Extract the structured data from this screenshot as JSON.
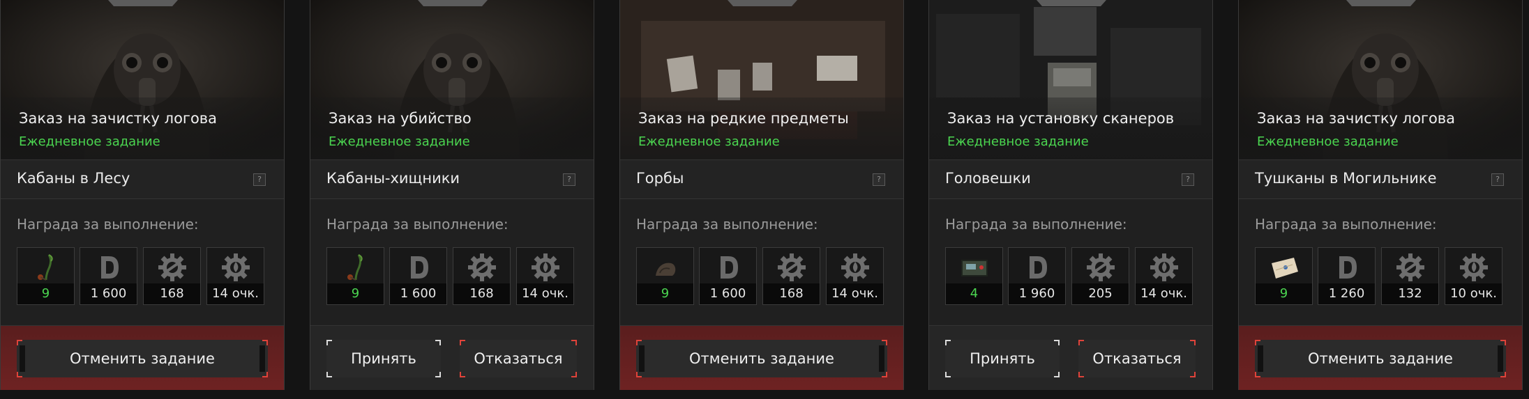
{
  "common": {
    "reward_label": "Награда за выполнение:",
    "help_symbol": "?"
  },
  "cards": [
    {
      "order_title": "Заказ на зачистку логова",
      "daily_label": "Ежедневное задание",
      "target": "Кабаны в Лесу",
      "art": "stalker",
      "rewards": [
        {
          "icon": "plant-icon",
          "value": "9",
          "highlight": true
        },
        {
          "icon": "currency-d-icon",
          "value": "1 600"
        },
        {
          "icon": "gear-wrench-icon",
          "value": "168"
        },
        {
          "icon": "gear-flame-icon",
          "value": "14 очк."
        }
      ],
      "buttons": {
        "cancel": "Отменить задание"
      }
    },
    {
      "order_title": "Заказ на убийство",
      "daily_label": "Ежедневное задание",
      "target": "Кабаны-хищники",
      "art": "stalker",
      "rewards": [
        {
          "icon": "plant-icon",
          "value": "9",
          "highlight": true
        },
        {
          "icon": "currency-d-icon",
          "value": "1 600"
        },
        {
          "icon": "gear-wrench-icon",
          "value": "168"
        },
        {
          "icon": "gear-flame-icon",
          "value": "14 очк."
        }
      ],
      "buttons": {
        "accept": "Принять",
        "decline": "Отказаться"
      }
    },
    {
      "order_title": "Заказ на редкие предметы",
      "daily_label": "Ежедневное задание",
      "target": "Горбы",
      "art": "board",
      "rewards": [
        {
          "icon": "hump-icon",
          "value": "9",
          "highlight": true
        },
        {
          "icon": "currency-d-icon",
          "value": "1 600"
        },
        {
          "icon": "gear-wrench-icon",
          "value": "168"
        },
        {
          "icon": "gear-flame-icon",
          "value": "14 очк."
        }
      ],
      "buttons": {
        "cancel": "Отменить задание"
      }
    },
    {
      "order_title": "Заказ на установку сканеров",
      "daily_label": "Ежедневное задание",
      "target": "Головешки",
      "art": "device",
      "rewards": [
        {
          "icon": "scanner-icon",
          "value": "4",
          "highlight": true
        },
        {
          "icon": "currency-d-icon",
          "value": "1 960"
        },
        {
          "icon": "gear-wrench-icon",
          "value": "205"
        },
        {
          "icon": "gear-flame-icon",
          "value": "14 очк."
        }
      ],
      "buttons": {
        "accept": "Принять",
        "decline": "Отказаться"
      }
    },
    {
      "order_title": "Заказ на зачистку логова",
      "daily_label": "Ежедневное задание",
      "target": "Тушканы в Могильнике",
      "art": "stalker",
      "rewards": [
        {
          "icon": "map-icon",
          "value": "9",
          "highlight": true
        },
        {
          "icon": "currency-d-icon",
          "value": "1 260"
        },
        {
          "icon": "gear-wrench-icon",
          "value": "132"
        },
        {
          "icon": "gear-flame-icon",
          "value": "10 очк."
        }
      ],
      "buttons": {
        "cancel": "Отменить задание"
      }
    }
  ],
  "colors": {
    "accent_green": "#4bd650",
    "active_footer": "#6e2222",
    "corner_red": "#e0433a"
  }
}
